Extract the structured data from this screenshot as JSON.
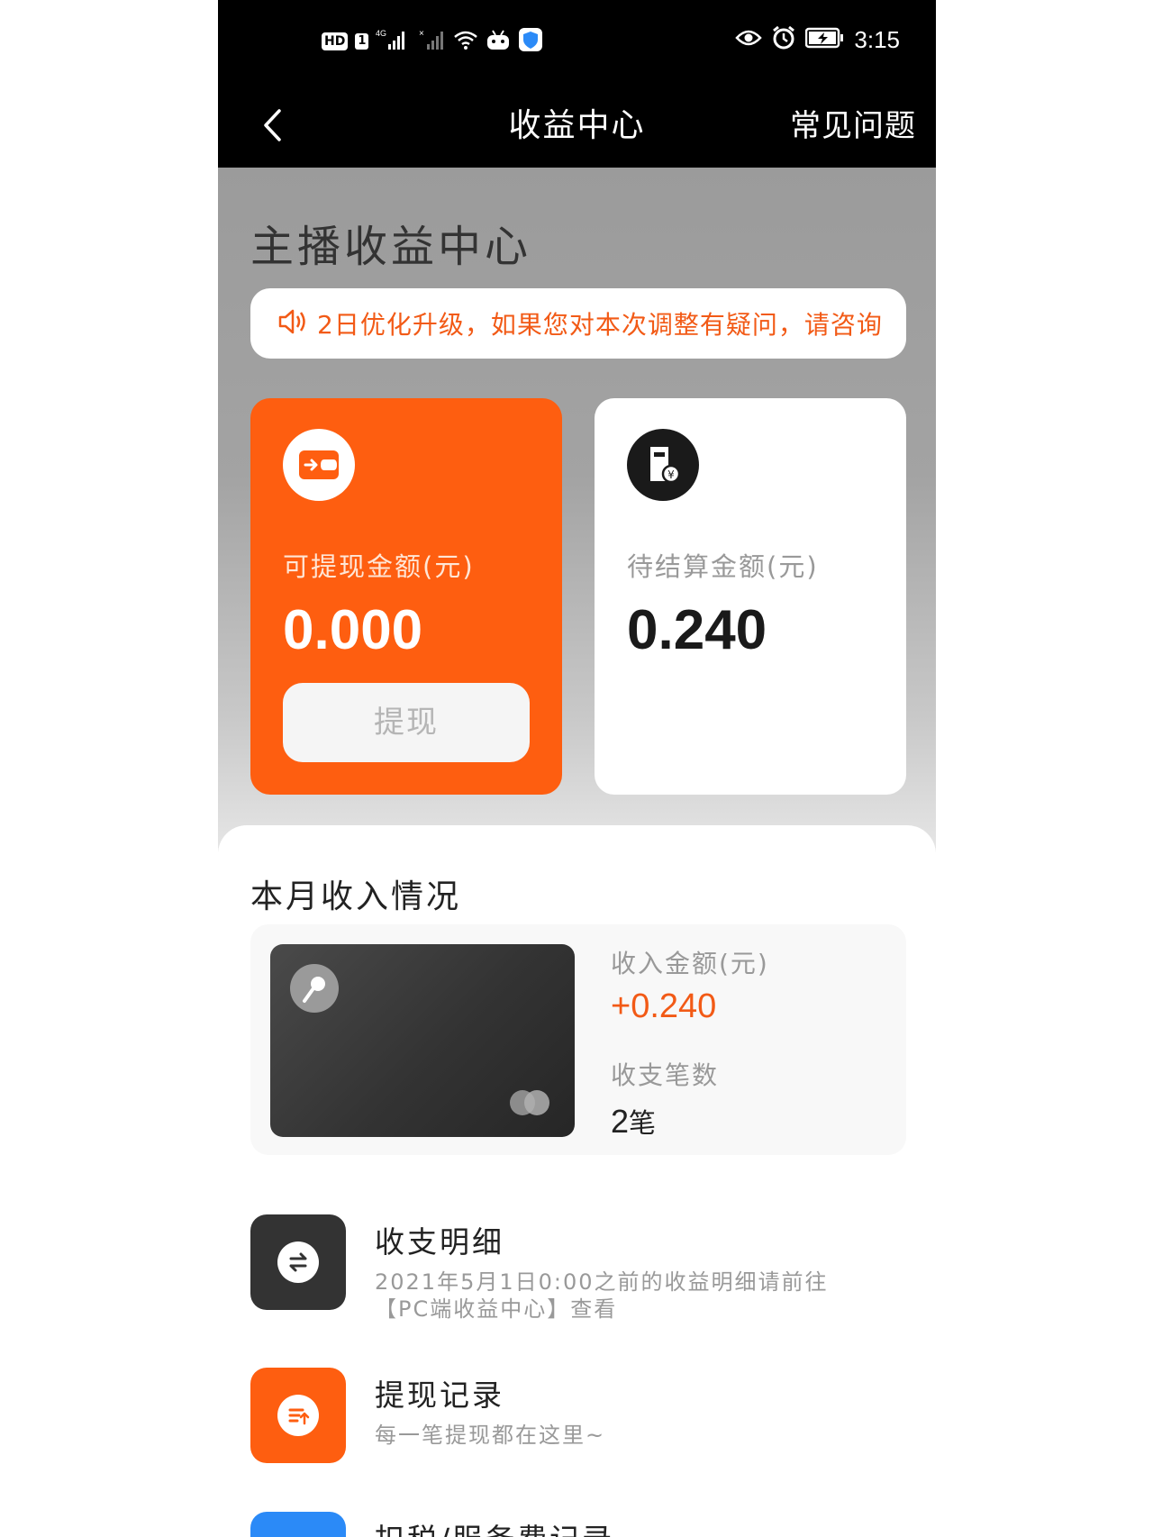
{
  "status_bar": {
    "hd": "HD",
    "sim": "1",
    "network": "4G",
    "time": "3:15",
    "icons": [
      "signal-icon",
      "signal-x-icon",
      "wifi-icon",
      "robot-icon",
      "shield-icon",
      "eye-icon",
      "alarm-icon",
      "battery-charging-icon"
    ]
  },
  "nav": {
    "back_icon": "chevron-left-icon",
    "title": "收益中心",
    "faq": "常见问题"
  },
  "hero": {
    "title": "主播收益中心",
    "notice": {
      "icon": "speaker-icon",
      "text": "2日优化升级，如果您对本次调整有疑问，请咨询"
    },
    "withdrawable": {
      "icon": "wallet-icon",
      "label": "可提现金额(元)",
      "value": "0.000",
      "button": "提现"
    },
    "pending": {
      "icon": "receipt-yen-icon",
      "label": "待结算金额(元)",
      "value": "0.240"
    }
  },
  "month": {
    "title": "本月收入情况",
    "card_logo_icon": "microphone-icon",
    "income_label": "收入金额(元)",
    "income_value": "+0.240",
    "count_label": "收支笔数",
    "count_value": "2",
    "count_unit": "笔"
  },
  "list": [
    {
      "icon": "exchange-icon",
      "title": "收支明细",
      "desc_line1": "2021年5月1日0:00之前的收益明细请前往",
      "desc_line2": "【PC端收益中心】查看"
    },
    {
      "icon": "withdraw-list-icon",
      "title": "提现记录",
      "desc_line1": "每一笔提现都在这里~"
    },
    {
      "icon": "tax-record-icon",
      "title": "扣税/服务费记录"
    }
  ],
  "colors": {
    "accent": "#fe5e10",
    "notice_text": "#f25a16",
    "blue": "#2b8af7",
    "dark": "#333333"
  }
}
